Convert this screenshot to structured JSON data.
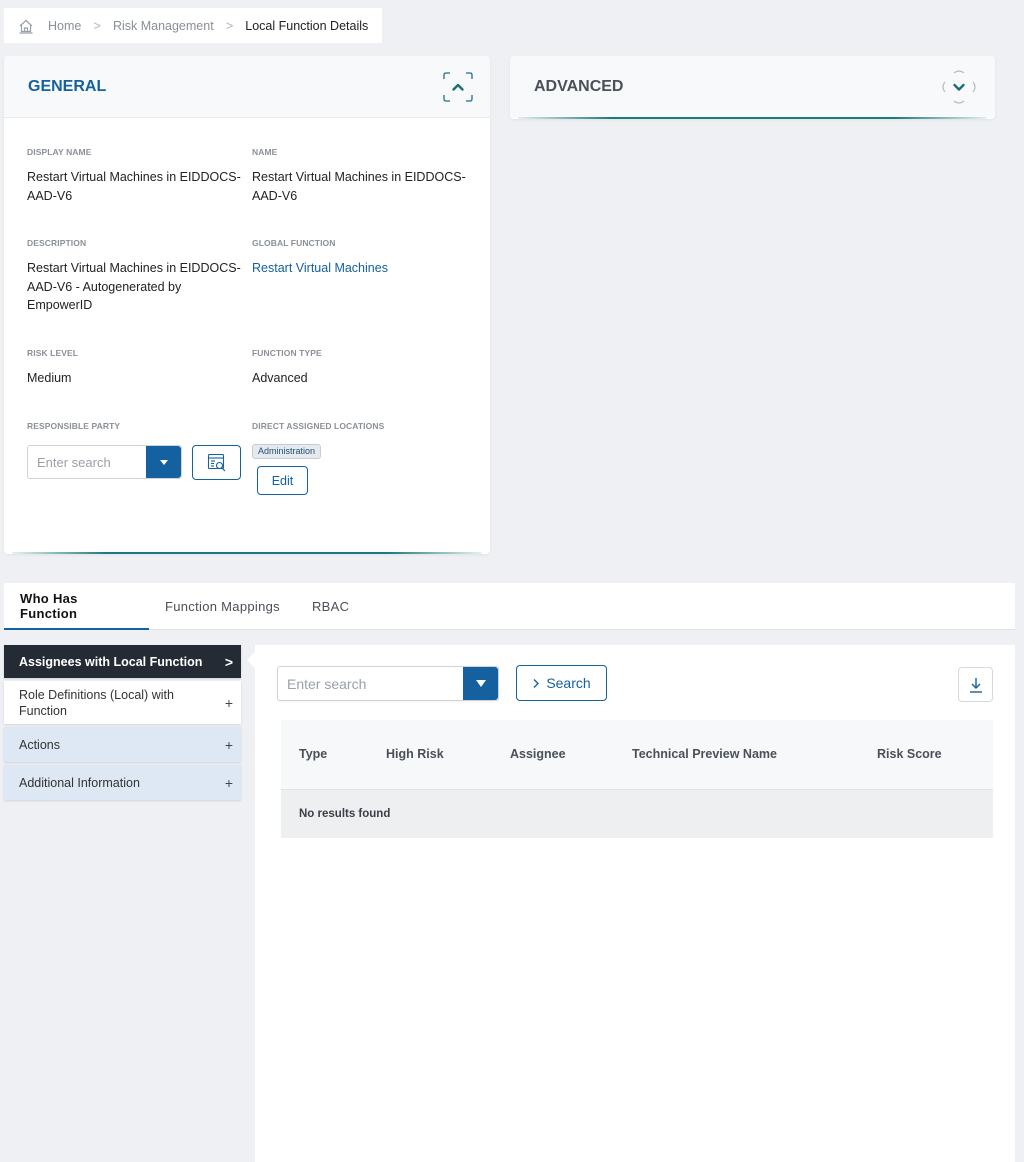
{
  "breadcrumb": {
    "home": "Home",
    "parent": "Risk Management",
    "current": "Local Function Details"
  },
  "general": {
    "title": "GENERAL",
    "display_name_label": "DISPLAY NAME",
    "display_name": "Restart Virtual Machines in EIDDOCS-AAD-V6",
    "name_label": "NAME",
    "name": "Restart Virtual Machines in EIDDOCS-AAD-V6",
    "description_label": "DESCRIPTION",
    "description": "Restart Virtual Machines in EIDDOCS-AAD-V6 - Autogenerated by EmpowerID",
    "global_function_label": "GLOBAL FUNCTION",
    "global_function": "Restart Virtual Machines",
    "risk_level_label": "RISK LEVEL",
    "risk_level": "Medium",
    "function_type_label": "FUNCTION TYPE",
    "function_type": "Advanced",
    "responsible_party_label": "RESPONSIBLE PARTY",
    "responsible_party_placeholder": "Enter search",
    "direct_locations_label": "DIRECT ASSIGNED LOCATIONS",
    "location_tag": "Administration",
    "edit_label": "Edit"
  },
  "advanced": {
    "title": "ADVANCED"
  },
  "tabs": [
    {
      "label": "Who Has Function"
    },
    {
      "label": "Function Mappings"
    },
    {
      "label": "RBAC"
    }
  ],
  "sidebar": {
    "items": [
      {
        "label": "Assignees with Local Function",
        "symbol": ">"
      },
      {
        "label": "Role Definitions (Local) with Function",
        "symbol": "+"
      },
      {
        "label": "Actions",
        "symbol": "+"
      },
      {
        "label": "Additional Information",
        "symbol": "+"
      }
    ]
  },
  "grid": {
    "search_placeholder": "Enter search",
    "search_label": "Search",
    "columns": [
      "Type",
      "High Risk",
      "Assignee",
      "Technical Preview Name",
      "Risk Score"
    ],
    "empty_text": "No results found"
  },
  "colors": {
    "primary": "#15609e",
    "sidebar_active": "#252b35",
    "sidebar_section": "#dde8f4",
    "accent_line": "#1b7a7a"
  }
}
